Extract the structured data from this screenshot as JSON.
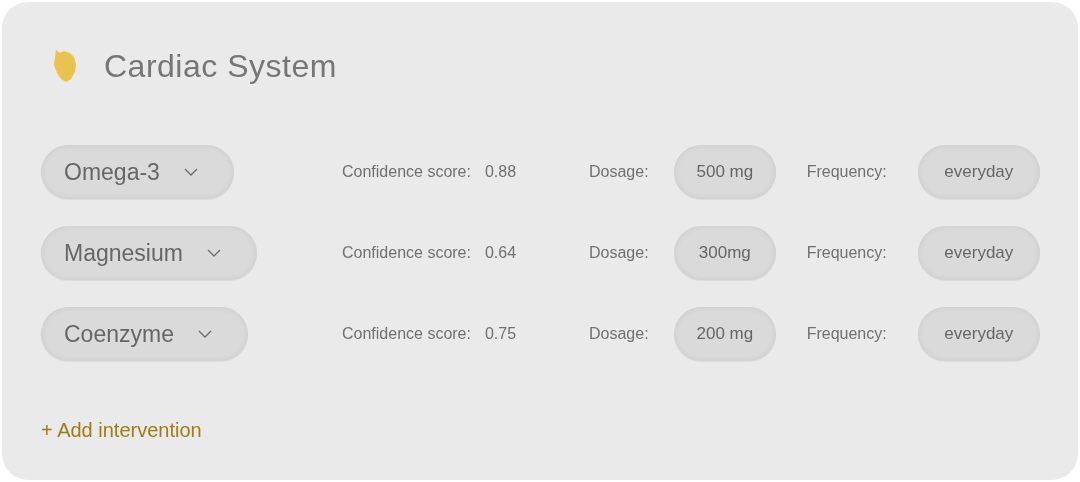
{
  "title": "Cardiac System",
  "interventions": [
    {
      "name": "Omega-3",
      "confidence_label": "Confidence score:",
      "confidence": "0.88",
      "dosage_label": "Dosage:",
      "dosage": "500 mg",
      "frequency_label": "Frequency:",
      "frequency": "everyday"
    },
    {
      "name": "Magnesium",
      "confidence_label": "Confidence score:",
      "confidence": "0.64",
      "dosage_label": "Dosage:",
      "dosage": "300mg",
      "frequency_label": "Frequency:",
      "frequency": "everyday"
    },
    {
      "name": "Coenzyme",
      "confidence_label": "Confidence score:",
      "confidence": "0.75",
      "dosage_label": "Dosage:",
      "dosage": "200 mg",
      "frequency_label": "Frequency:",
      "frequency": "everyday"
    }
  ],
  "add_button": "+ Add intervention"
}
